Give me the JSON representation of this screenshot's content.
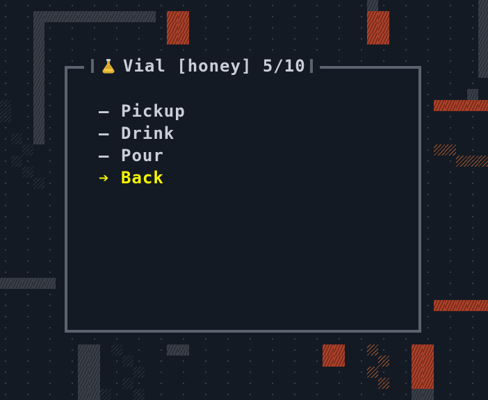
{
  "dialog": {
    "title": "Vial [honey] 5/10",
    "icon": "potion-flask-icon",
    "menu": [
      {
        "label": "Pickup",
        "marker": "–",
        "selected": false
      },
      {
        "label": "Drink",
        "marker": "–",
        "selected": false
      },
      {
        "label": "Pour",
        "marker": "–",
        "selected": false
      },
      {
        "label": "Back",
        "marker": "➔",
        "selected": true
      }
    ]
  },
  "colors": {
    "background": "#141a24",
    "border": "#5c6370",
    "text": "#c9ced8",
    "selected": "#f5f500",
    "wall_red": "#b3452c",
    "wall_gray": "#3b424c"
  }
}
